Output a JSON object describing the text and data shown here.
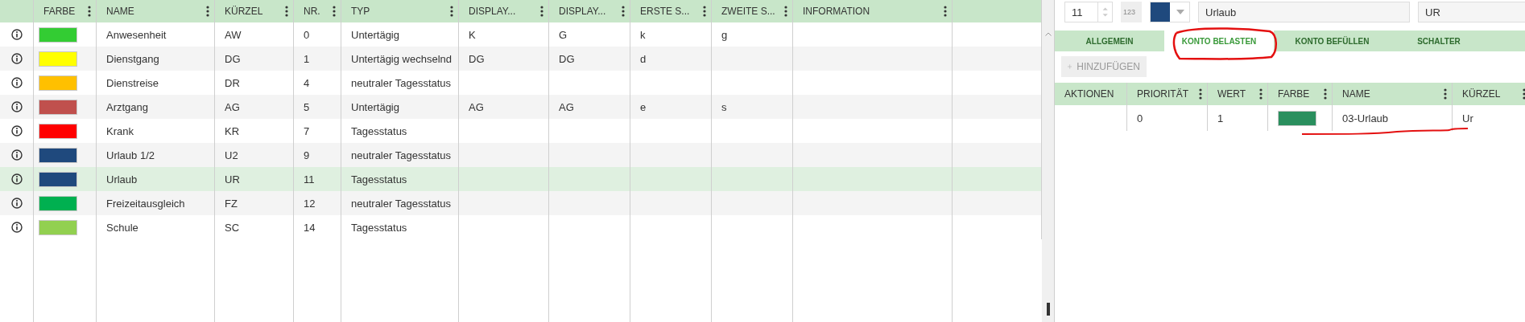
{
  "main_table": {
    "columns": [
      {
        "menu": false
      },
      {
        "label": "FARBE",
        "menu": true
      },
      {
        "label": "NAME",
        "menu": true
      },
      {
        "label": "KÜRZEL",
        "menu": true
      },
      {
        "label": "NR.",
        "menu": true
      },
      {
        "label": "TYP",
        "menu": true
      },
      {
        "label": "DISPLAY...",
        "menu": true
      },
      {
        "label": "DISPLAY...",
        "menu": true
      },
      {
        "label": "ERSTE S...",
        "menu": true
      },
      {
        "label": "ZWEITE S...",
        "menu": true
      },
      {
        "label": "INFORMATION",
        "menu": true
      },
      {
        "menu": false
      }
    ],
    "rows": [
      {
        "color": "#33cc33",
        "name": "Anwesenheit",
        "kuerzel": "AW",
        "nr": "0",
        "typ": "Untertägig",
        "display_1": "K",
        "display_2": "G",
        "erste": "k",
        "zweite": "g",
        "selected": false
      },
      {
        "color": "#ffff00",
        "name": "Dienstgang",
        "kuerzel": "DG",
        "nr": "1",
        "typ": "Untertägig wechselnd",
        "display_1": "DG",
        "display_2": "DG",
        "erste": "d",
        "zweite": "",
        "selected": false
      },
      {
        "color": "#ffc000",
        "name": "Dienstreise",
        "kuerzel": "DR",
        "nr": "4",
        "typ": "neutraler Tagesstatus",
        "display_1": "",
        "display_2": "",
        "erste": "",
        "zweite": "",
        "selected": false
      },
      {
        "color": "#c0504d",
        "name": "Arztgang",
        "kuerzel": "AG",
        "nr": "5",
        "typ": "Untertägig",
        "display_1": "AG",
        "display_2": "AG",
        "erste": "e",
        "zweite": "s",
        "selected": false
      },
      {
        "color": "#ff0000",
        "name": "Krank",
        "kuerzel": "KR",
        "nr": "7",
        "typ": "Tagesstatus",
        "display_1": "",
        "display_2": "",
        "erste": "",
        "zweite": "",
        "selected": false
      },
      {
        "color": "#1f497d",
        "name": "Urlaub 1/2",
        "kuerzel": "U2",
        "nr": "9",
        "typ": "neutraler Tagesstatus",
        "display_1": "",
        "display_2": "",
        "erste": "",
        "zweite": "",
        "selected": false
      },
      {
        "color": "#1f497d",
        "name": "Urlaub",
        "kuerzel": "UR",
        "nr": "11",
        "typ": "Tagesstatus",
        "display_1": "",
        "display_2": "",
        "erste": "",
        "zweite": "",
        "selected": true
      },
      {
        "color": "#00b050",
        "name": "Freizeitausgleich",
        "kuerzel": "FZ",
        "nr": "12",
        "typ": "neutraler Tagesstatus",
        "display_1": "",
        "display_2": "",
        "erste": "",
        "zweite": "",
        "selected": false
      },
      {
        "color": "#92d050",
        "name": "Schule",
        "kuerzel": "SC",
        "nr": "14",
        "typ": "Tagesstatus",
        "display_1": "",
        "display_2": "",
        "erste": "",
        "zweite": "",
        "selected": false
      }
    ]
  },
  "detail": {
    "number_value": "11",
    "number_toggle": "123",
    "name_value": "Urlaub",
    "short_value": "UR",
    "tabs": [
      {
        "label": "ALLGEMEIN",
        "selected": false
      },
      {
        "label": "KONTO BELASTEN",
        "selected": true
      },
      {
        "label": "KONTO BEFÜLLEN",
        "selected": false
      },
      {
        "label": "SCHALTER",
        "selected": false
      }
    ],
    "add_button": {
      "label": "HINZUFÜGEN",
      "disabled": true
    },
    "table": {
      "columns": [
        {
          "label": "AKTIONEN",
          "menu": false
        },
        {
          "label": "PRIORITÄT",
          "menu": true
        },
        {
          "label": "WERT",
          "menu": true
        },
        {
          "label": "FARBE",
          "menu": true
        },
        {
          "label": "NAME",
          "menu": true
        },
        {
          "label": "KÜRZEL",
          "menu": true
        }
      ],
      "rows": [
        {
          "prioritaet": "0",
          "wert": "1",
          "color": "#2a8f5e",
          "name": "03-Urlaub",
          "kuerzel": "Ur"
        }
      ]
    }
  }
}
